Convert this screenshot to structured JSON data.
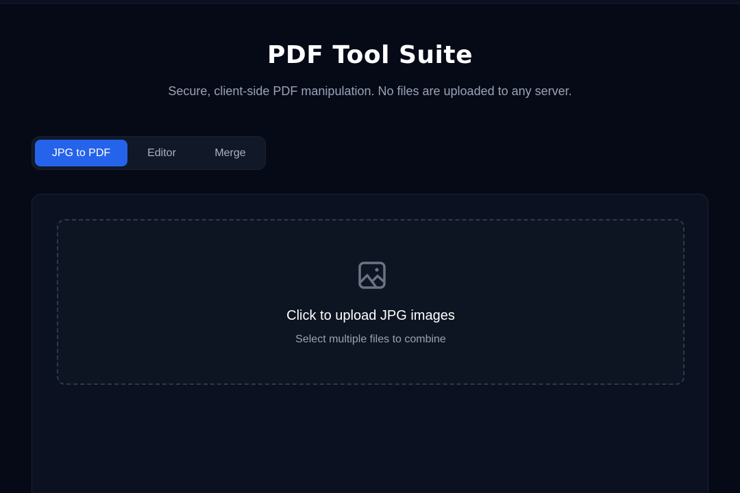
{
  "header": {
    "title": "PDF Tool Suite",
    "subtitle": "Secure, client-side PDF manipulation. No files are uploaded to any server."
  },
  "tabs": [
    {
      "label": "JPG to PDF",
      "active": true
    },
    {
      "label": "Editor",
      "active": false
    },
    {
      "label": "Merge",
      "active": false
    }
  ],
  "upload": {
    "icon": "image-icon",
    "title": "Click to upload JPG images",
    "hint": "Select multiple files to combine"
  },
  "colors": {
    "background": "#060a17",
    "accent": "#2563eb",
    "card": "#0b1120"
  }
}
